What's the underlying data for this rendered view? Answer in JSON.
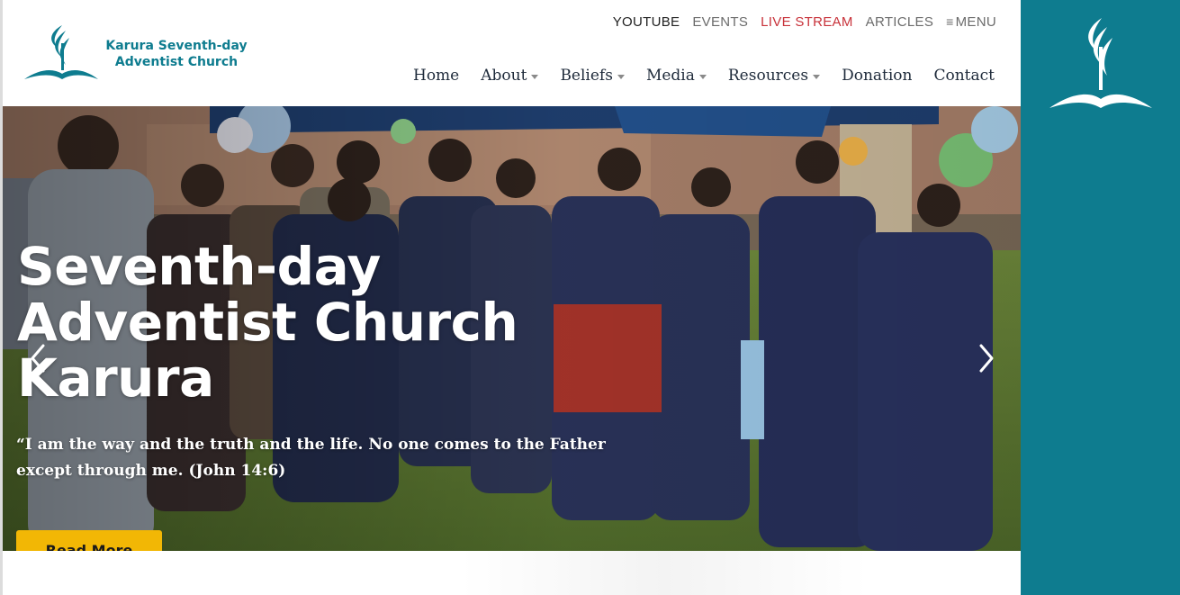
{
  "brand": {
    "name_line1": "Karura Seventh-day",
    "name_line2": "Adventist Church",
    "logo_icon": "adventist-flame-bible-icon",
    "accent_color": "#0e7c8f"
  },
  "topnav": {
    "youtube": "YOUTUBE",
    "events": "EVENTS",
    "live_stream": "LIVE STREAM",
    "articles": "ARTICLES",
    "menu_icon": "≡",
    "menu": "MENU",
    "live_color": "#c8323a"
  },
  "mainnav": {
    "home": "Home",
    "about": "About",
    "beliefs": "Beliefs",
    "media": "Media",
    "resources": "Resources",
    "donation": "Donation",
    "contact": "Contact"
  },
  "hero": {
    "title_line1": "Seventh-day",
    "title_line2": "Adventist Church",
    "title_line3": "Karura",
    "quote_line1": "“I am the way and the truth and the life. No one comes to the Father",
    "quote_line2": "except through me. (John 14:6)",
    "button": "Read More",
    "button_color": "#f2b705"
  },
  "sidebar": {
    "logo_icon": "adventist-flame-bible-icon",
    "background": "#0e7c8f"
  }
}
